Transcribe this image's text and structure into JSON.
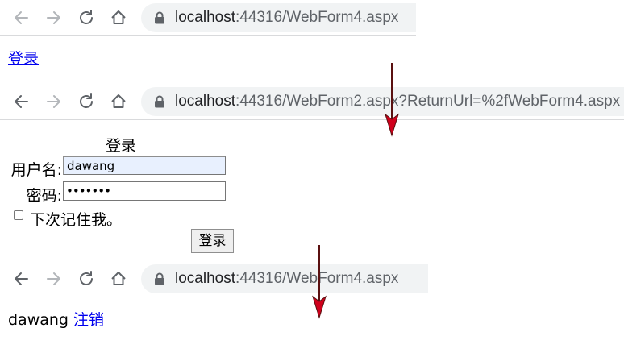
{
  "screen1": {
    "url_host": "localhost",
    "url_path": ":44316/WebForm4.aspx",
    "login_link": "登录"
  },
  "screen2": {
    "url_host": "localhost",
    "url_path": ":44316/WebForm2.aspx?ReturnUrl=%2fWebForm4.aspx",
    "form_title": "登录",
    "username_label": "用户名:",
    "username_value": "dawang",
    "password_label": "密码:",
    "password_value": "•••••••",
    "remember_label": "下次记住我。",
    "remember_checked": false,
    "login_button": "登录"
  },
  "screen3": {
    "url_host": "localhost",
    "url_path": ":44316/WebForm4.aspx",
    "username": "dawang",
    "logout_link": "注销"
  },
  "colors": {
    "arrow": "#b0001a",
    "link": "#0000ee",
    "omnibox": "#f1f3f4",
    "autofill": "#e8f0fe"
  },
  "icons": [
    "back-arrow-icon",
    "forward-arrow-icon",
    "reload-icon",
    "home-icon",
    "lock-icon",
    "down-arrow-icon"
  ]
}
